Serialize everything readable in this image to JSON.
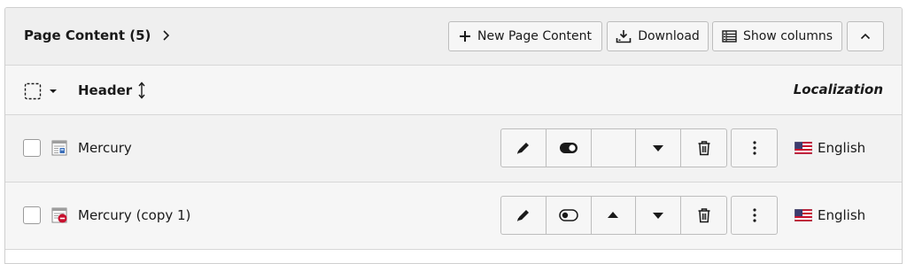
{
  "panel": {
    "title": "Page Content (5)",
    "buttons": {
      "new_content": "New Page Content",
      "download": "Download",
      "show_columns": "Show columns"
    }
  },
  "columns": {
    "header": "Header",
    "localization": "Localization"
  },
  "rows": [
    {
      "title": "Mercury",
      "language": "English",
      "icon": "content-text-picture-icon",
      "visibility": "visible"
    },
    {
      "title": "Mercury (copy 1)",
      "language": "English",
      "icon": "content-hidden-icon",
      "visibility": "hidden"
    }
  ],
  "icons": {
    "accent_red": "#c8102e",
    "accent_blue": "#3c6fb8"
  }
}
